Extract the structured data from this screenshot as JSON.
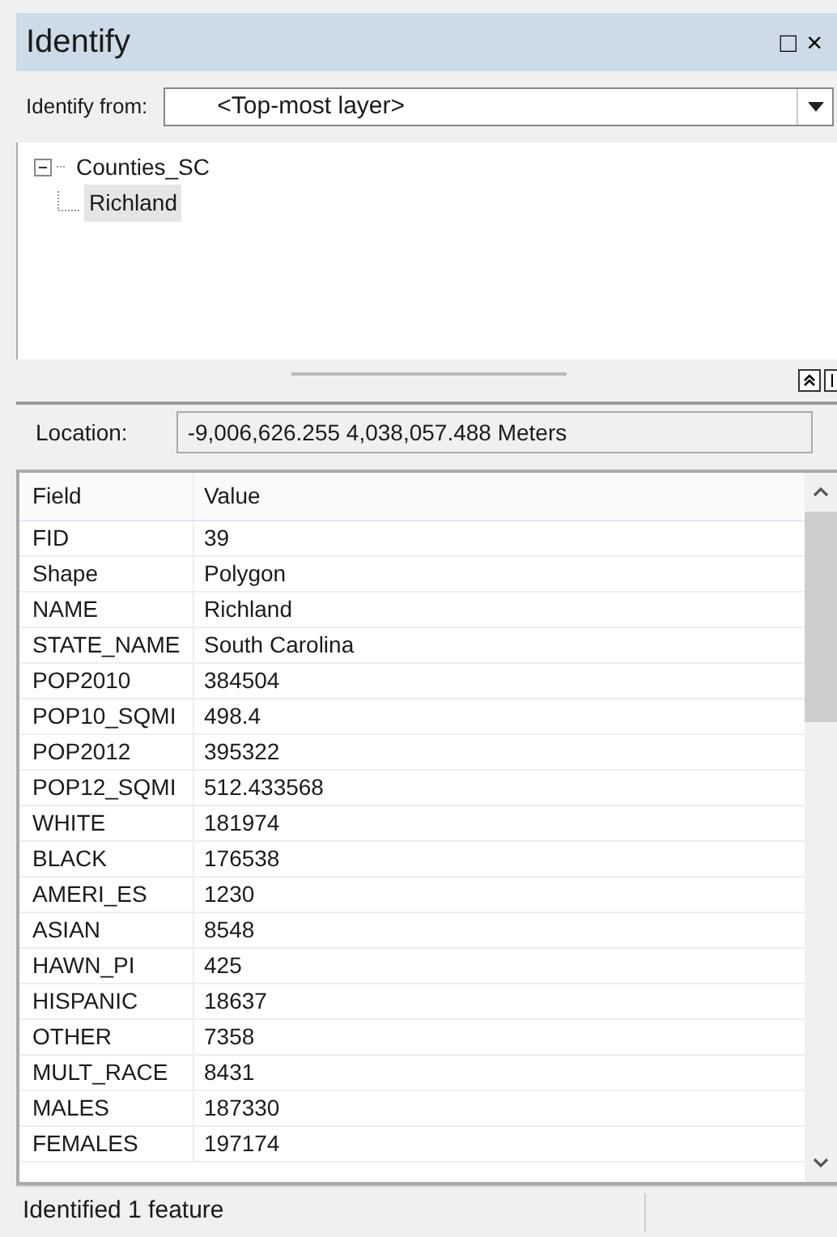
{
  "window": {
    "title": "Identify",
    "buttons": [
      "□",
      "×"
    ]
  },
  "identify_from": {
    "label": "Identify from:",
    "value": "<Top-most layer>"
  },
  "tree": [
    {
      "label": "Counties_SC",
      "expanded": true,
      "selected": false,
      "children": [
        {
          "label": "Richland",
          "selected": true
        }
      ]
    }
  ],
  "location": {
    "label": "Location:",
    "value": "-9,006,626.255  4,038,057.488 Meters"
  },
  "table": {
    "columns": [
      "Field",
      "Value"
    ],
    "rows": [
      [
        "FID",
        "39"
      ],
      [
        "Shape",
        "Polygon"
      ],
      [
        "NAME",
        "Richland"
      ],
      [
        "STATE_NAME",
        "South Carolina"
      ],
      [
        "POP2010",
        "384504"
      ],
      [
        "POP10_SQMI",
        "498.4"
      ],
      [
        "POP2012",
        "395322"
      ],
      [
        "POP12_SQMI",
        "512.433568"
      ],
      [
        "WHITE",
        "181974"
      ],
      [
        "BLACK",
        "176538"
      ],
      [
        "AMERI_ES",
        "1230"
      ],
      [
        "ASIAN",
        "8548"
      ],
      [
        "HAWN_PI",
        "425"
      ],
      [
        "HISPANIC",
        "18637"
      ],
      [
        "OTHER",
        "7358"
      ],
      [
        "MULT_RACE",
        "8431"
      ],
      [
        "MALES",
        "187330"
      ],
      [
        "FEMALES",
        "197174"
      ]
    ]
  },
  "status_bar": "Identified 1 feature"
}
